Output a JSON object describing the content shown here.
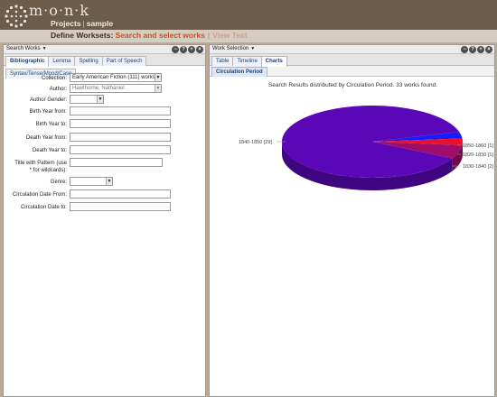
{
  "header": {
    "logo": "m·o·n·k",
    "projects": "Projects",
    "project_name": "sample",
    "separator": "|"
  },
  "subnav": {
    "define": "Define Worksets:",
    "active": "Search and select works",
    "separator": "|",
    "view_text": "View Text"
  },
  "left_panel": {
    "title": "Search Works",
    "tabs": [
      "Bibliographic",
      "Lemma",
      "Spelling",
      "Part of Speech",
      "Syntax/Tense/Mood/Case"
    ],
    "fields": {
      "collection": {
        "label": "Collection:",
        "value": "Early American Fiction (111) works"
      },
      "author": {
        "label": "Author:",
        "value": "Hawthorne, Nathaniel"
      },
      "author_gender": {
        "label": "Author Gender:",
        "value": ""
      },
      "birth_from": {
        "label": "Birth Year from:",
        "value": ""
      },
      "birth_to": {
        "label": "Birth Year to:",
        "value": ""
      },
      "death_from": {
        "label": "Death Year from:",
        "value": ""
      },
      "death_to": {
        "label": "Death Year to:",
        "value": ""
      },
      "title_pattern": {
        "label_1": "Title with Pattern (use",
        "label_2": "* for wildcards):",
        "value": ""
      },
      "genre": {
        "label": "Genre:",
        "value": ""
      },
      "circ_from": {
        "label": "Circulation Date From:",
        "value": ""
      },
      "circ_to": {
        "label": "Circulation Date to:",
        "value": ""
      }
    }
  },
  "right_panel": {
    "title": "Work Selection",
    "tabs": [
      "Table",
      "Timeline",
      "Charts"
    ],
    "subtab": "Circulation Period"
  },
  "chart_data": {
    "type": "pie",
    "title": "Search Results distributed by Circulation Period. 33 works found.",
    "categories": [
      "1840-1850",
      "1850-1860",
      "1820-1830",
      "1830-1840"
    ],
    "values": [
      29,
      1,
      1,
      2
    ],
    "labels": [
      "1840-1850 [29]",
      "1850-1860 [1]",
      "1820-1830 [1]",
      "1830-1840 [2]"
    ],
    "colors": [
      "#5a07b8",
      "#1a1aff",
      "#e8102a",
      "#a00c6a"
    ]
  }
}
